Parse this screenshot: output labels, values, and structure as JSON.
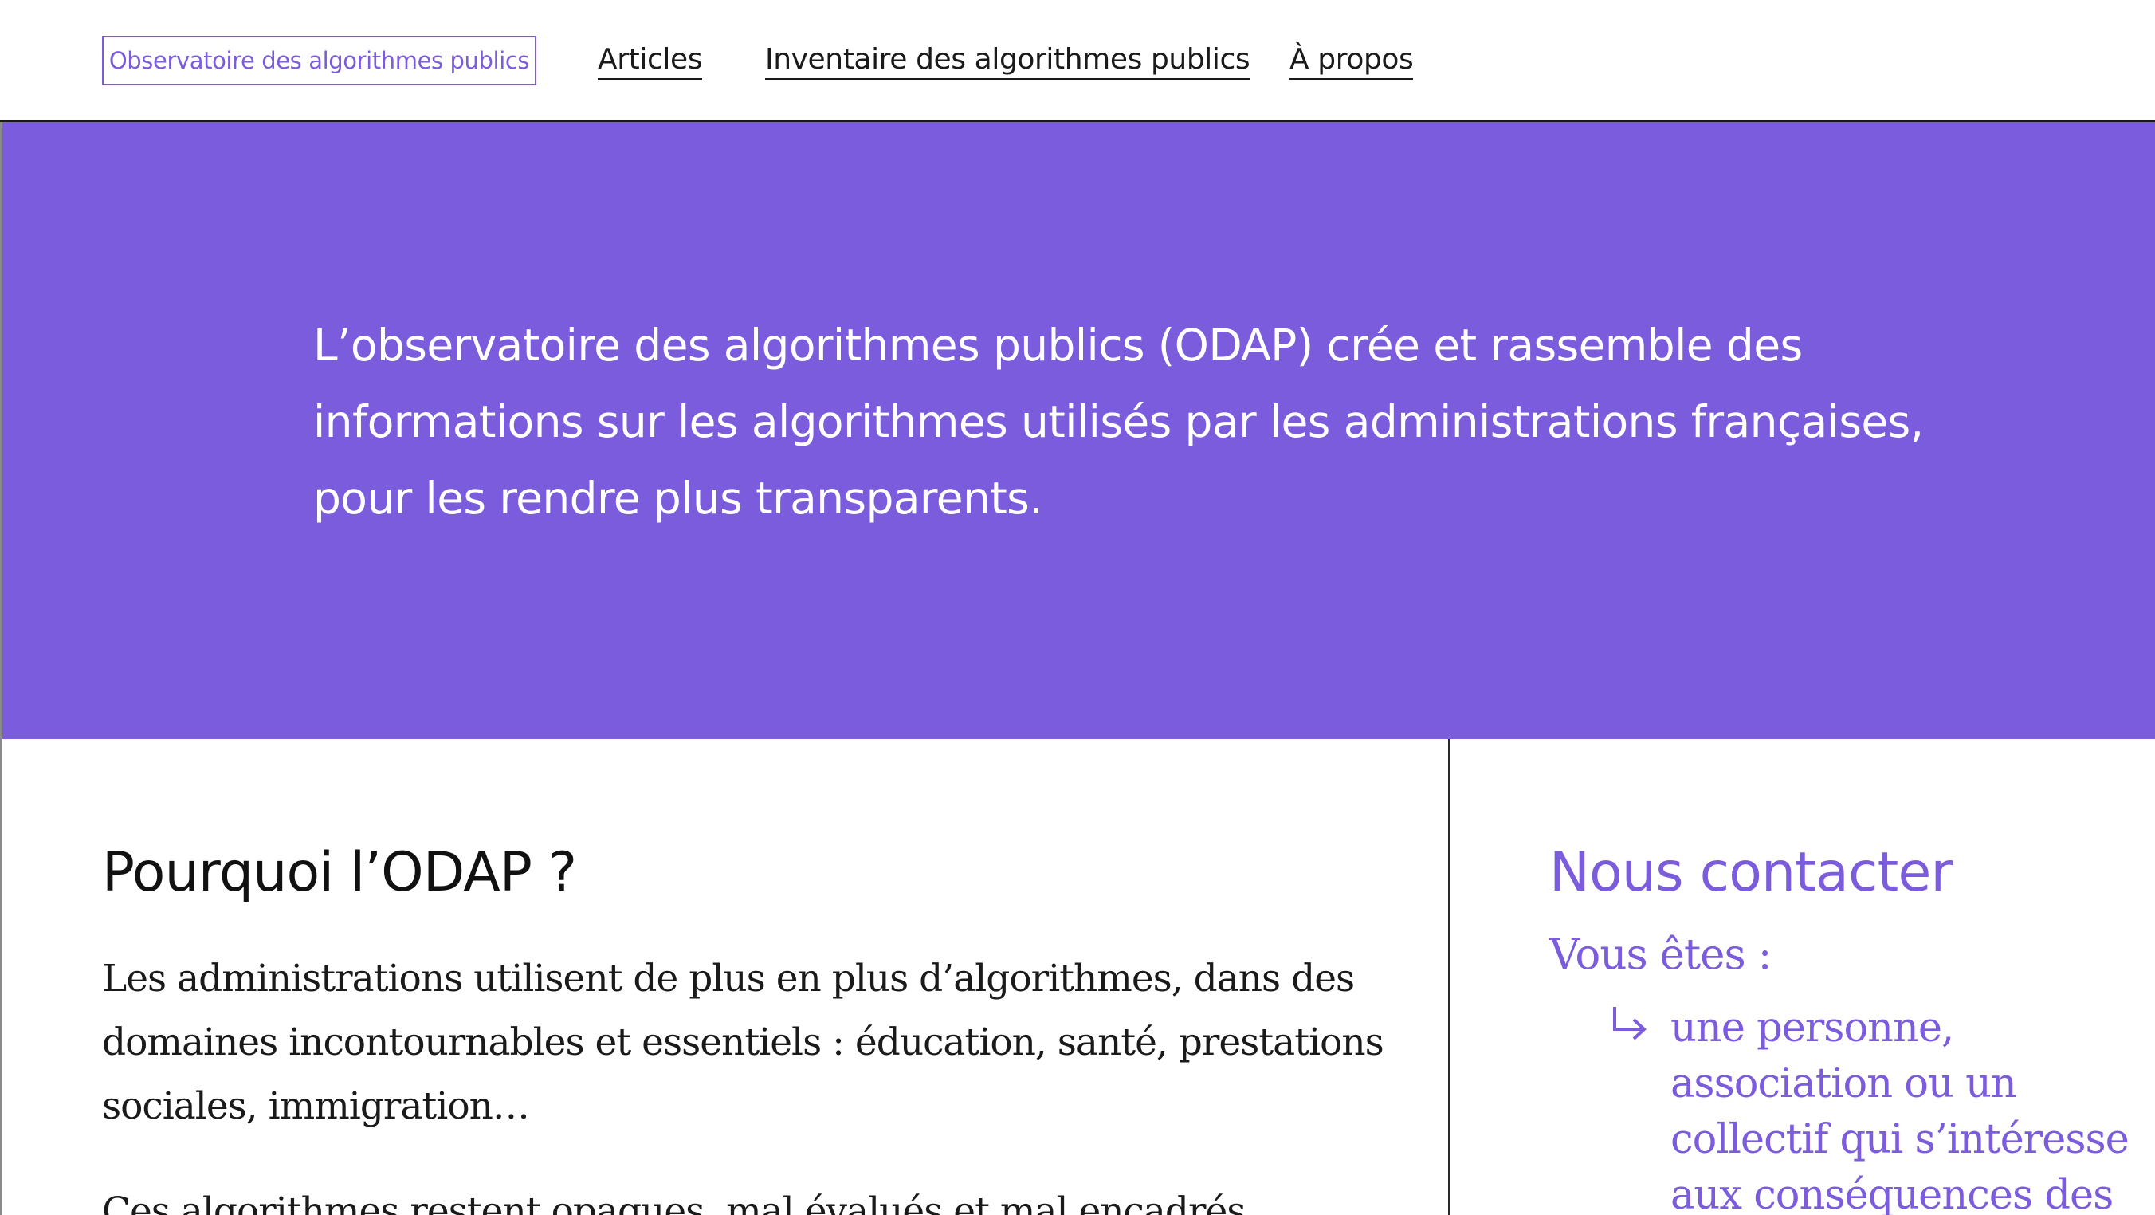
{
  "header": {
    "brand_label": "Observatoire des algorithmes publics",
    "nav": {
      "articles": "Articles",
      "inventaire": "Inventaire des algorithmes publics",
      "apropos": "À propos"
    }
  },
  "hero": {
    "text": "L’observatoire des algorithmes publics (ODAP) crée et rassemble des informations sur les algorithmes utilisés par les administrations françaises, pour les rendre plus transparents."
  },
  "why": {
    "title": "Pourquoi l’ODAP ?",
    "paragraph1": "Les administrations utilisent de plus en plus d’algorithmes, dans des domaines incontournables et essentiels : éducation, santé, prestations sociales, immigration…",
    "paragraph2": "Ces algorithmes restent opaques, mal évalués et mal encadrés."
  },
  "contact": {
    "title": "Nous contacter",
    "subtitle": "Vous êtes :",
    "option1": "une personne, association ou un collectif qui s’intéresse aux conséquences des",
    "arrow_icon": "return-arrow-icon"
  },
  "colors": {
    "accent": "#7a5cdd",
    "text": "#111111",
    "background": "#ffffff"
  }
}
